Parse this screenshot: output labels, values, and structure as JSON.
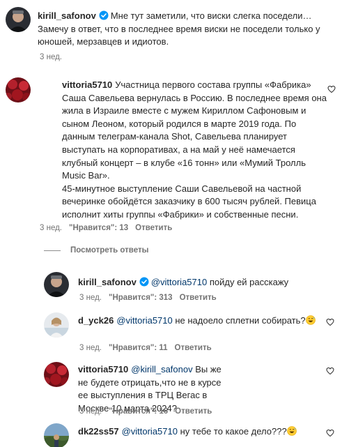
{
  "comments": [
    {
      "username": "kirill_safonov",
      "verified": true,
      "text": "Мне тут заметили, что виски слегка поседели… Замечу в ответ, что в последнее время виски не поседели только у юношей, мерзавцев и идиотов.",
      "time": "3 нед."
    },
    {
      "username": "vittoria5710",
      "verified": false,
      "text": "Участница первого состава группы «Фабрика» Саша Савельева вернулась в Россию. В последнее время она жила в Израиле вместе с мужем Кириллом Сафоновым и сыном Леоном, который родился в марте 2019 года. По данным телеграм-канала Shot, Савельева планирует выступать на корпоративах, а на май у неё намечается клубный концерт – в клубе «16 тонн» или «Мумий Тролль Music Bar».",
      "text2": "45-минутное выступление Саши Савельевой на частной вечеринке обойдётся заказчику в 600 тысяч рублей. Певица исполнит хиты группы «Фабрики» и собственные песни.",
      "time": "3 нед.",
      "likes": "\"Нравится\": 13",
      "reply": "Ответить"
    }
  ],
  "view_replies": "Посмотреть ответы",
  "replies": [
    {
      "username": "kirill_safonov",
      "verified": true,
      "mention": "@vittoria5710",
      "text": "пойду ей расскажу",
      "time": "3 нед.",
      "likes": "\"Нравится\": 313",
      "reply": "Ответить"
    },
    {
      "username": "d_yck26",
      "verified": false,
      "mention": "@vittoria5710",
      "text": "не надоело сплетни собирать?",
      "time": "3 нед.",
      "likes": "\"Нравится\": 11",
      "reply": "Ответить"
    },
    {
      "username": "vittoria5710",
      "verified": false,
      "mention": "@kirill_safonov",
      "text": "Вы же не будете отрицать,что не в курсе ее выступления в ТРЦ Вегас в Москве 10 марта 2024?",
      "time": "3 нед.",
      "likes": "\"Нравится\": 16",
      "reply": "Ответить"
    },
    {
      "username": "dk22ss57",
      "verified": false,
      "mention": "@vittoria5710",
      "text": "ну тебе то какое дело???",
      "time": "",
      "likes": "",
      "reply": ""
    }
  ],
  "icons": {
    "verified": "verified-badge-icon",
    "heart": "heart-outline-icon",
    "emoji": "grinning-sweat-emoji"
  },
  "colors": {
    "verified": "#0095f6",
    "mention": "#00376b",
    "meta": "#737373"
  }
}
